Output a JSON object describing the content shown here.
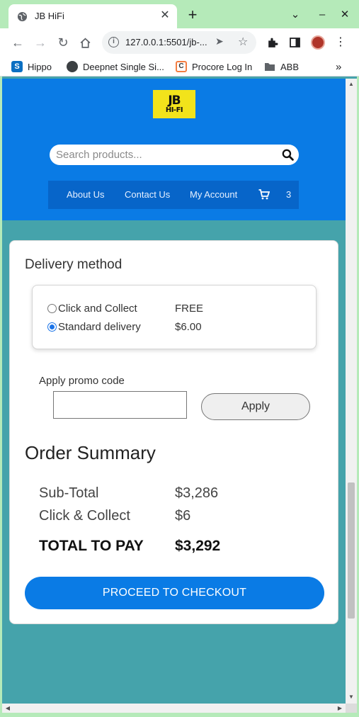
{
  "browser": {
    "tab_title": "JB HiFi",
    "url": "127.0.0.1:5501/jb-...",
    "bookmarks": [
      {
        "label": "Hippo",
        "icon": "sharepoint-icon"
      },
      {
        "label": "Deepnet Single Si...",
        "icon": "globe-icon"
      },
      {
        "label": "Procore Log In",
        "icon": "procore-icon"
      },
      {
        "label": "ABB",
        "icon": "folder-icon"
      }
    ],
    "overflow": "»"
  },
  "site": {
    "logo_top": "JB",
    "logo_bottom": "HI-FI",
    "search_placeholder": "Search products...",
    "nav": [
      "About Us",
      "Contact Us",
      "My Account"
    ],
    "cart_count": "3"
  },
  "delivery": {
    "heading": "Delivery method",
    "options": [
      {
        "label": "Click and Collect",
        "price": "FREE",
        "selected": false
      },
      {
        "label": "Standard delivery",
        "price": "$6.00",
        "selected": true
      }
    ]
  },
  "promo": {
    "label": "Apply promo code",
    "value": "",
    "button": "Apply"
  },
  "summary": {
    "heading": "Order Summary",
    "rows": [
      {
        "label": "Sub-Total",
        "value": "$3,286"
      },
      {
        "label": "Click & Collect",
        "value": "$6"
      }
    ],
    "total_label": "TOTAL TO PAY",
    "total_value": "$3,292",
    "checkout": "PROCEED TO CHECKOUT"
  },
  "colors": {
    "brand_blue": "#0a7be5",
    "nav_blue": "#0765c9",
    "page_bg": "#45a3ab",
    "logo_yellow": "#f2e31b",
    "chrome_green": "#b5eab9"
  }
}
